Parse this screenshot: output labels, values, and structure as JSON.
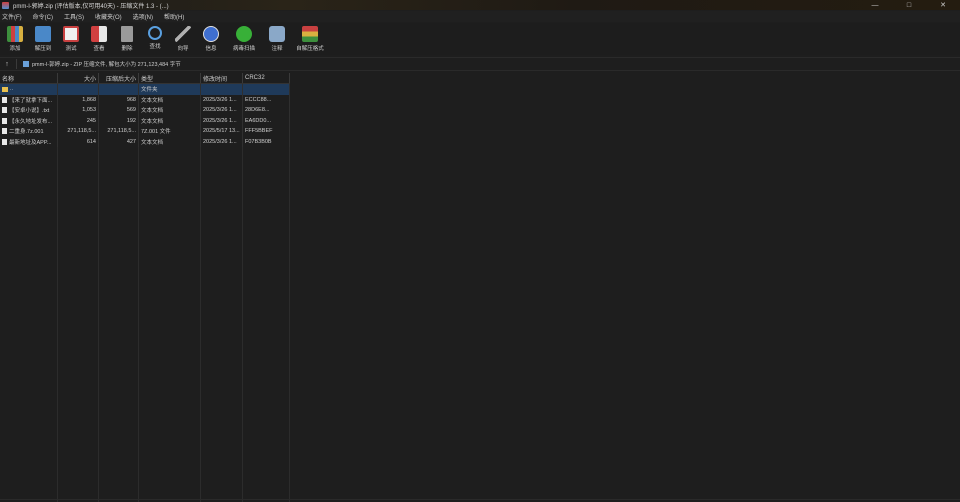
{
  "window": {
    "title": "pmm-l-郭婷.zip (评估版本,仅可用40天) - 压缩文件 1.3 - (...)",
    "min": "—",
    "max": "□",
    "close": "✕"
  },
  "menu": [
    "文件(F)",
    "命令(C)",
    "工具(S)",
    "收藏夹(O)",
    "选项(N)",
    "帮助(H)"
  ],
  "toolbar": [
    {
      "label": "添加",
      "icon": "add-icon",
      "color": "#3d8f3d"
    },
    {
      "label": "解压到",
      "icon": "extract-icon",
      "color": "#4a88c8"
    },
    {
      "label": "测试",
      "icon": "test-icon",
      "color": "#c84040"
    },
    {
      "label": "查看",
      "icon": "view-icon",
      "color": "#d8b040"
    },
    {
      "label": "删除",
      "icon": "delete-icon",
      "color": "#8a8a8a"
    },
    {
      "label": "查找",
      "icon": "find-icon",
      "color": "#5aa0e0"
    },
    {
      "label": "向导",
      "icon": "wizard-icon",
      "color": "#a0a0a0"
    },
    {
      "label": "信息",
      "icon": "info-icon",
      "color": "#4a7ad8"
    },
    {
      "label": "病毒扫描",
      "icon": "scan-icon",
      "color": "#38b038"
    },
    {
      "label": "注释",
      "icon": "comment-icon",
      "color": "#7aa0c8"
    },
    {
      "label": "自解压格式",
      "icon": "sfx-icon",
      "color": "#c86a30"
    }
  ],
  "path": {
    "up": "↑",
    "text": "pmm-l-郭婷.zip - ZIP 压缩文件, 解包大小为 271,123,484 字节"
  },
  "columns": [
    "名称",
    "大小",
    "压缩后大小",
    "类型",
    "修改时间",
    "CRC32"
  ],
  "rows": [
    {
      "name": "..",
      "size": "",
      "packed": "",
      "type": "文件夹",
      "modified": "",
      "crc": "",
      "icon": "folder-icon",
      "selected": true
    },
    {
      "name": "【来了就拿下面...",
      "size": "1,868",
      "packed": "968",
      "type": "文本文档",
      "modified": "2025/3/26 1...",
      "crc": "ECCC88...",
      "icon": "file-icon"
    },
    {
      "name": "【安卓小说】.txt",
      "size": "1,053",
      "packed": "569",
      "type": "文本文档",
      "modified": "2025/3/26 1...",
      "crc": "28D6E8...",
      "icon": "file-icon"
    },
    {
      "name": "【永久地址发布...",
      "size": "245",
      "packed": "192",
      "type": "文本文档",
      "modified": "2025/3/26 1...",
      "crc": "EA6DD0...",
      "icon": "file-icon"
    },
    {
      "name": "二重身.7z.001",
      "size": "271,118,5...",
      "packed": "271,118,5...",
      "type": "7Z.001 文件",
      "modified": "2025/5/17 13...",
      "crc": "FFF5BBEF",
      "icon": "file-icon"
    },
    {
      "name": "最新地址及APP...",
      "size": "614",
      "packed": "427",
      "type": "文本文档",
      "modified": "2025/3/26 1...",
      "crc": "F07B3B0B",
      "icon": "file-icon"
    }
  ]
}
